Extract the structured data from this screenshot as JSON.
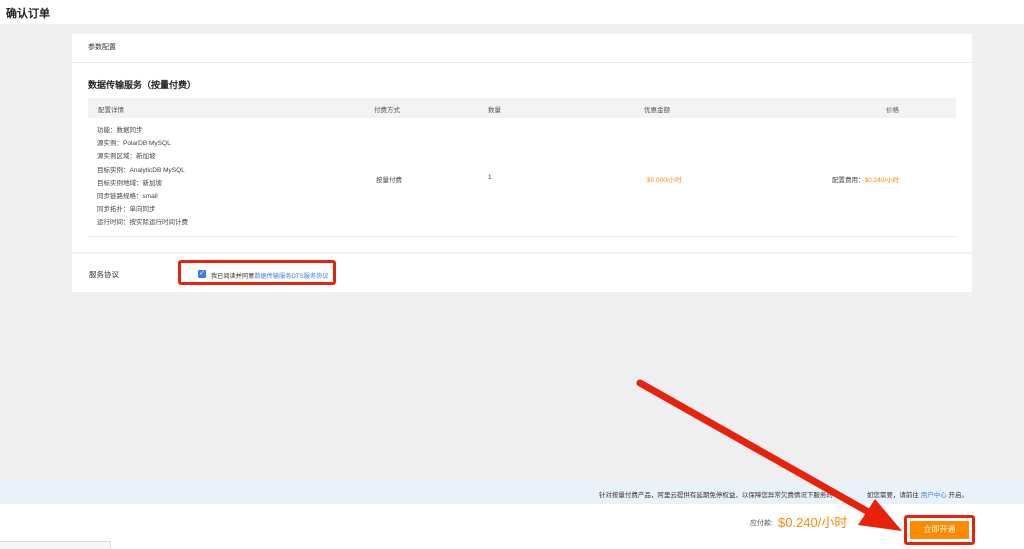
{
  "page": {
    "title": "确认订单"
  },
  "config_card": {
    "header": "参数配置",
    "service_title": "数据传输服务（按量付费）",
    "columns": [
      "配置详情",
      "付费方式",
      "数量",
      "优惠金额",
      "价格"
    ],
    "row": {
      "details": [
        "功能：数据同步",
        "源实例：PolarDB MySQL",
        "源实例区域：新加坡",
        "目标实例：AnalyticDB MySQL",
        "目标实例地域：新加坡",
        "同步链路规格：small",
        "同步拓扑：单向同步",
        "运行时间：按实际运行时间计费"
      ],
      "payment": "按量付费",
      "quantity": "1",
      "discount": "$0.000/小时",
      "price_label": "配置费用：",
      "price_value": "$0.240/小时"
    }
  },
  "agreement": {
    "label": "服务协议",
    "prefix": "我已阅读并同意",
    "link_text": "数据传输服务DTS服务协议",
    "checked": true
  },
  "notice": {
    "text": "针对按量付费产品，阿里云提供有延期免停权益，以保障您异常欠费情况下服务的",
    "text_tail": "如您需要，请前往",
    "link_text": "用户中心",
    "suffix": "开启。"
  },
  "footer": {
    "pay_label": "应付款:",
    "pay_amount": "$0.240/小时",
    "open_button": "立即开通"
  },
  "colors": {
    "accent": "#ff8a00",
    "link": "#3e7fe6",
    "highlight": "#e8210a"
  }
}
